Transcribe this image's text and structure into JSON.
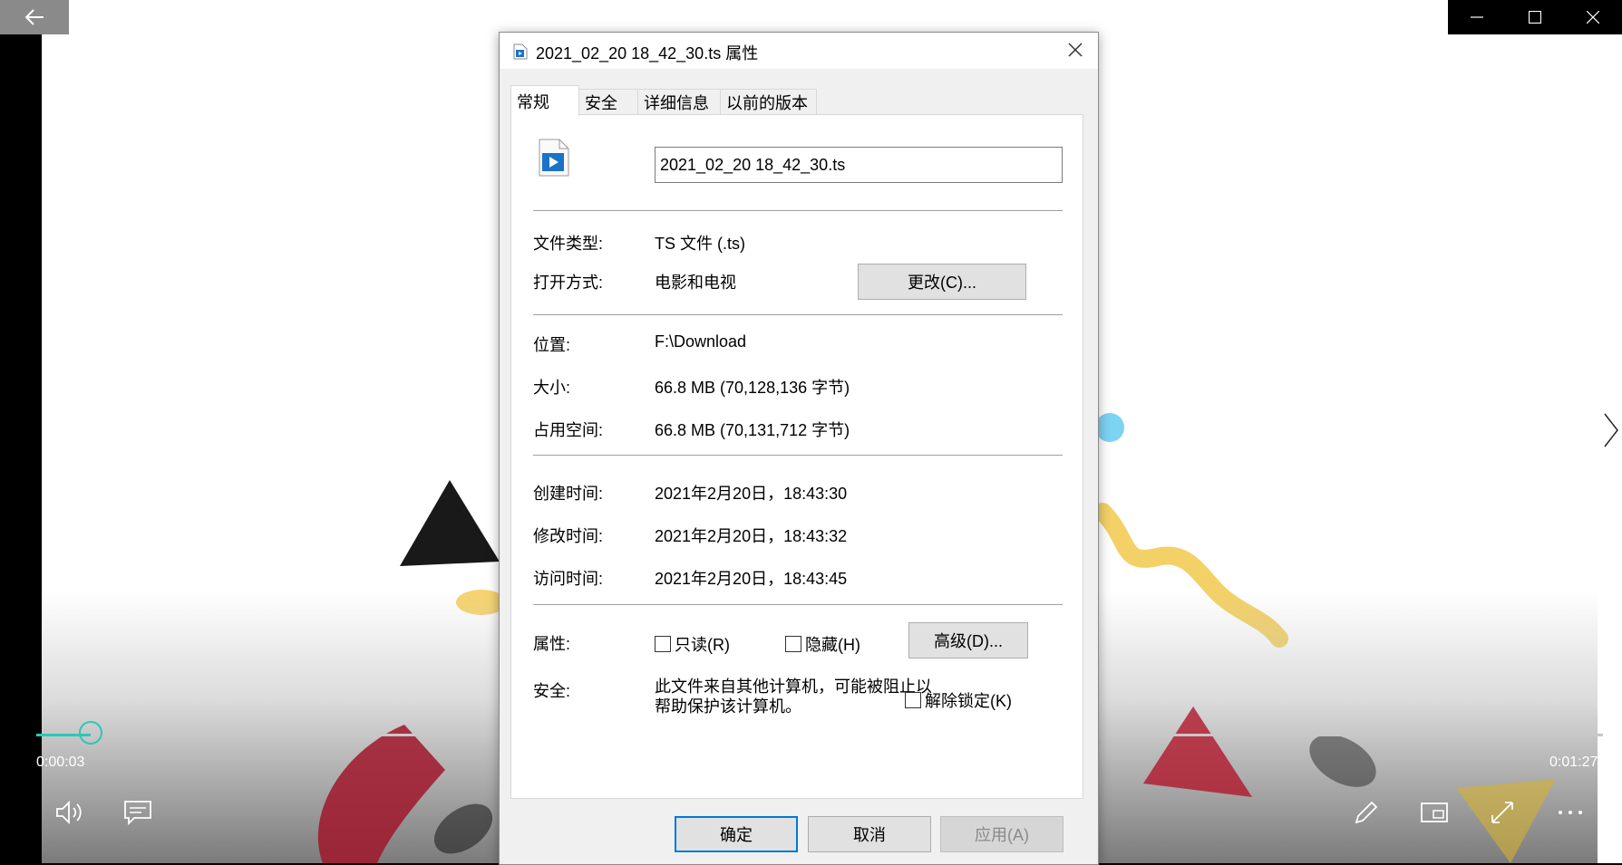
{
  "player": {
    "current_time": "0:00:03",
    "total_time": "0:01:27",
    "progress_fraction": 0.035,
    "accent_color": "#2bc7b8"
  },
  "icons": {
    "back": "arrow-left-icon",
    "minimize": "minimize-icon",
    "maximize": "maximize-icon",
    "close": "close-icon",
    "next": "chevron-right-icon",
    "volume": "volume-icon",
    "subtitles": "subtitles-icon",
    "edit": "pencil-icon",
    "miniview": "miniview-icon",
    "fullscreen": "fullscreen-icon",
    "more": "more-icon"
  },
  "dialog": {
    "title": "2021_02_20 18_42_30.ts 属性",
    "tabs": [
      "常规",
      "安全",
      "详细信息",
      "以前的版本"
    ],
    "active_tab": "常规",
    "filename": "2021_02_20 18_42_30.ts",
    "rows": {
      "type_label": "文件类型:",
      "type_value": "TS 文件 (.ts)",
      "opens_label": "打开方式:",
      "opens_value": "电影和电视",
      "change_button": "更改(C)...",
      "location_label": "位置:",
      "location_value": "F:\\Download",
      "size_label": "大小:",
      "size_value": "66.8 MB (70,128,136 字节)",
      "disk_label": "占用空间:",
      "disk_value": "66.8 MB (70,131,712 字节)",
      "created_label": "创建时间:",
      "created_value": "2021年2月20日，18:43:30",
      "modified_label": "修改时间:",
      "modified_value": "2021年2月20日，18:43:32",
      "accessed_label": "访问时间:",
      "accessed_value": "2021年2月20日，18:43:45",
      "attributes_label": "属性:",
      "readonly_label": "只读(R)",
      "hidden_label": "隐藏(H)",
      "advanced_button": "高级(D)...",
      "security_label": "安全:",
      "security_text": "此文件来自其他计算机，可能被阻止以帮助保护该计算机。",
      "unblock_label": "解除锁定(K)"
    },
    "checkboxes": {
      "readonly": false,
      "hidden": false,
      "unblock": false
    },
    "buttons": {
      "ok": "确定",
      "cancel": "取消",
      "apply": "应用(A)"
    }
  }
}
